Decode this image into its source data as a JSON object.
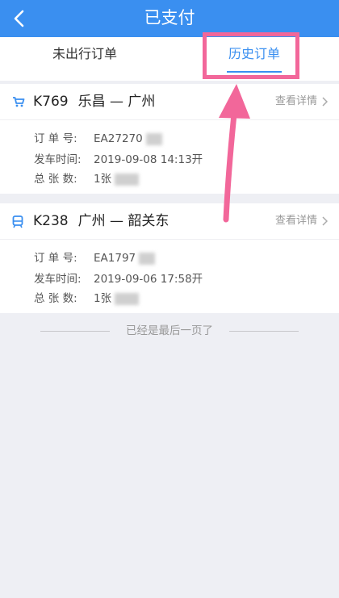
{
  "header": {
    "title": "已支付",
    "back_icon": "chevron-left-icon"
  },
  "tabs": [
    {
      "label": "未出行订单",
      "active": false
    },
    {
      "label": "历史订单",
      "active": true
    }
  ],
  "orders": [
    {
      "train_icon": "cart-icon",
      "train_no": "K769",
      "route": "乐昌 — 广州",
      "detail_label": "查看详情",
      "order_no_label": "订 单 号:",
      "order_no": "EA27270",
      "depart_label": "发车时间:",
      "depart_time": "2019-09-08   14:13开",
      "count_label": "总 张 数:",
      "count": "1张"
    },
    {
      "train_icon": "train-icon",
      "train_no": "K238",
      "route": "广州 — 韶关东",
      "detail_label": "查看详情",
      "order_no_label": "订 单 号:",
      "order_no": "EA1797",
      "depart_label": "发车时间:",
      "depart_time": "2019-09-06   17:58开",
      "count_label": "总 张 数:",
      "count": "1张"
    }
  ],
  "footer_note": "已经是最后一页了",
  "colors": {
    "primary": "#3a8ff0",
    "annotation": "#f2679a",
    "background": "#eeeff4"
  }
}
